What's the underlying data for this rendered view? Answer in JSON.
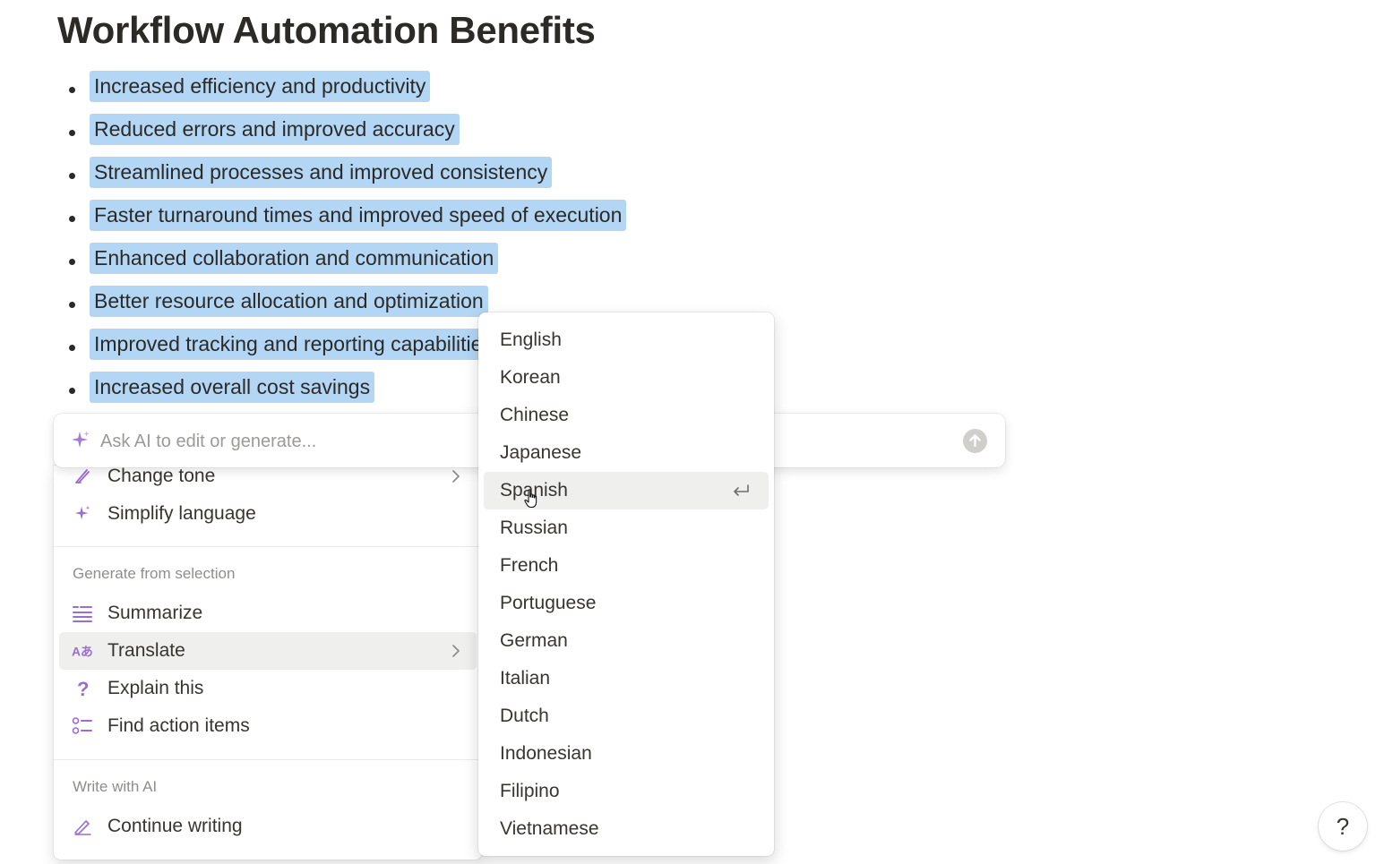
{
  "page": {
    "title": "Workflow Automation Benefits",
    "bullets": [
      "Increased efficiency and productivity",
      "Reduced errors and improved accuracy",
      "Streamlined processes and improved consistency",
      "Faster turnaround times and improved speed of execution",
      "Enhanced collaboration and communication",
      "Better resource allocation and optimization",
      "Improved tracking and reporting capabilities",
      "Increased overall cost savings"
    ]
  },
  "ai_bar": {
    "placeholder": "Ask AI to edit or generate..."
  },
  "ai_menu": {
    "items_top": [
      {
        "label": "Change tone",
        "icon": "tone-icon"
      },
      {
        "label": "Simplify language",
        "icon": "sparkle-icon"
      }
    ],
    "section_generate": "Generate from selection",
    "items_generate": [
      {
        "label": "Summarize",
        "icon": "summarize-icon"
      },
      {
        "label": "Translate",
        "icon": "translate-icon"
      },
      {
        "label": "Explain this",
        "icon": "question-icon"
      },
      {
        "label": "Find action items",
        "icon": "checklist-icon"
      }
    ],
    "section_write": "Write with AI",
    "items_write": [
      {
        "label": "Continue writing",
        "icon": "pen-icon"
      }
    ],
    "active_item": "Translate"
  },
  "languages": {
    "items": [
      "English",
      "Korean",
      "Chinese",
      "Japanese",
      "Spanish",
      "Russian",
      "French",
      "Portuguese",
      "German",
      "Italian",
      "Dutch",
      "Indonesian",
      "Filipino",
      "Vietnamese"
    ],
    "hovered": "Spanish"
  },
  "help": {
    "label": "?"
  },
  "colors": {
    "selection": "#b3d6f5",
    "accent_purple": "#9a6dd7",
    "hover_bg": "#efefee"
  }
}
